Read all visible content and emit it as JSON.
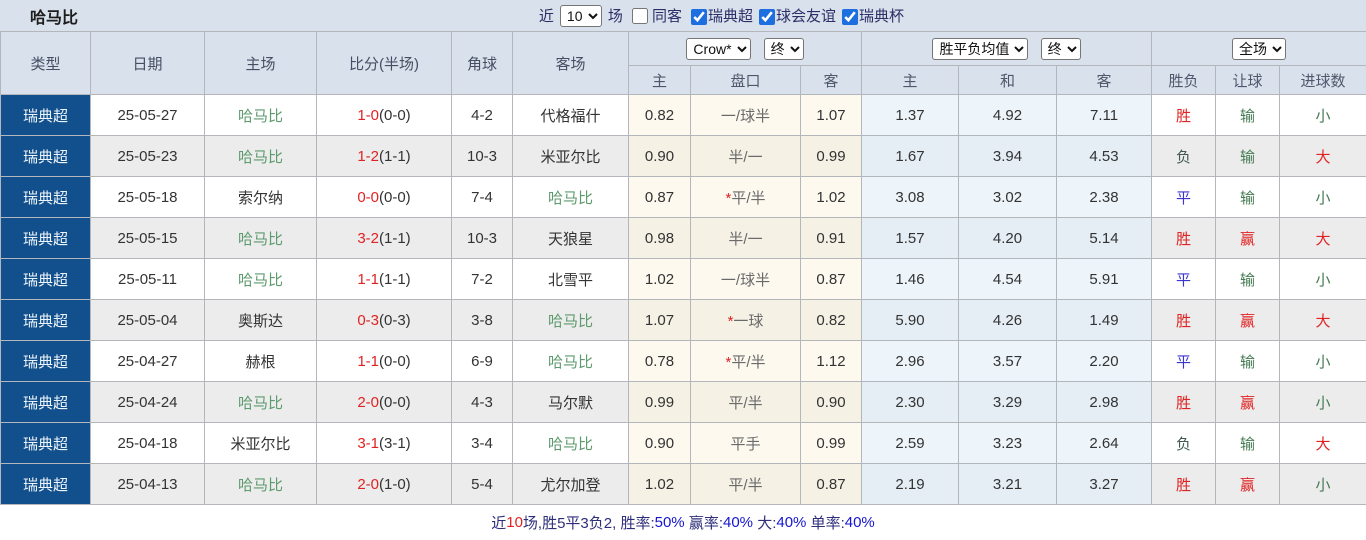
{
  "topbar": {
    "title": "哈马比",
    "recent_label": "近",
    "recent_value": "10",
    "matches_label": "场",
    "same_venue": {
      "label": "同客",
      "checked": false
    },
    "filters": [
      {
        "label": "瑞典超",
        "checked": true
      },
      {
        "label": "球会友谊",
        "checked": true
      },
      {
        "label": "瑞典杯",
        "checked": true
      }
    ]
  },
  "table": {
    "static_headers": {
      "type": "类型",
      "date": "日期",
      "home": "主场",
      "score": "比分(半场)",
      "corners": "角球",
      "away": "客场"
    },
    "handicap_group": {
      "provider_select": "Crow*",
      "time_select": "终",
      "subheaders": [
        "主",
        "盘口",
        "客"
      ]
    },
    "odds_group": {
      "type_select": "胜平负均值",
      "time_select": "终",
      "subheaders": [
        "主",
        "和",
        "客"
      ]
    },
    "result_group": {
      "scope_select": "全场",
      "subheaders": [
        "胜负",
        "让球",
        "进球数"
      ]
    },
    "colors": {
      "accent_header_bg": "#d9e1ec",
      "league_bg": "#11508c",
      "red": "#e02222",
      "green": "#457a52",
      "blue": "#3c35cc"
    },
    "rows": [
      {
        "league": "瑞典超",
        "date": "25-05-27",
        "home": "哈马比",
        "home_is_subject": true,
        "score": "1-0",
        "half": "(0-0)",
        "corners": "4-2",
        "away": "代格福什",
        "away_is_subject": false,
        "ah_home": "0.82",
        "ah_star": false,
        "ah_line": "一/球半",
        "ah_away": "1.07",
        "eu_home": "1.37",
        "eu_draw": "4.92",
        "eu_away": "7.11",
        "result": "胜",
        "result_color": "red",
        "handicap_result": "输",
        "handicap_color": "green",
        "goals": "小",
        "goals_color": "green"
      },
      {
        "league": "瑞典超",
        "date": "25-05-23",
        "home": "哈马比",
        "home_is_subject": true,
        "score": "1-2",
        "half": "(1-1)",
        "corners": "10-3",
        "away": "米亚尔比",
        "away_is_subject": false,
        "ah_home": "0.90",
        "ah_star": false,
        "ah_line": "半/一",
        "ah_away": "0.99",
        "eu_home": "1.67",
        "eu_draw": "3.94",
        "eu_away": "4.53",
        "result": "负",
        "result_color": "dark",
        "handicap_result": "输",
        "handicap_color": "green",
        "goals": "大",
        "goals_color": "red"
      },
      {
        "league": "瑞典超",
        "date": "25-05-18",
        "home": "索尔纳",
        "home_is_subject": false,
        "score": "0-0",
        "half": "(0-0)",
        "corners": "7-4",
        "away": "哈马比",
        "away_is_subject": true,
        "ah_home": "0.87",
        "ah_star": true,
        "ah_line": "平/半",
        "ah_away": "1.02",
        "eu_home": "3.08",
        "eu_draw": "3.02",
        "eu_away": "2.38",
        "result": "平",
        "result_color": "blue",
        "handicap_result": "输",
        "handicap_color": "green",
        "goals": "小",
        "goals_color": "green"
      },
      {
        "league": "瑞典超",
        "date": "25-05-15",
        "home": "哈马比",
        "home_is_subject": true,
        "score": "3-2",
        "half": "(1-1)",
        "corners": "10-3",
        "away": "天狼星",
        "away_is_subject": false,
        "ah_home": "0.98",
        "ah_star": false,
        "ah_line": "半/一",
        "ah_away": "0.91",
        "eu_home": "1.57",
        "eu_draw": "4.20",
        "eu_away": "5.14",
        "result": "胜",
        "result_color": "red",
        "handicap_result": "赢",
        "handicap_color": "red",
        "goals": "大",
        "goals_color": "red"
      },
      {
        "league": "瑞典超",
        "date": "25-05-11",
        "home": "哈马比",
        "home_is_subject": true,
        "score": "1-1",
        "half": "(1-1)",
        "corners": "7-2",
        "away": "北雪平",
        "away_is_subject": false,
        "ah_home": "1.02",
        "ah_star": false,
        "ah_line": "一/球半",
        "ah_away": "0.87",
        "eu_home": "1.46",
        "eu_draw": "4.54",
        "eu_away": "5.91",
        "result": "平",
        "result_color": "blue",
        "handicap_result": "输",
        "handicap_color": "green",
        "goals": "小",
        "goals_color": "green"
      },
      {
        "league": "瑞典超",
        "date": "25-05-04",
        "home": "奥斯达",
        "home_is_subject": false,
        "score": "0-3",
        "half": "(0-3)",
        "corners": "3-8",
        "away": "哈马比",
        "away_is_subject": true,
        "ah_home": "1.07",
        "ah_star": true,
        "ah_line": "一球",
        "ah_away": "0.82",
        "eu_home": "5.90",
        "eu_draw": "4.26",
        "eu_away": "1.49",
        "result": "胜",
        "result_color": "red",
        "handicap_result": "赢",
        "handicap_color": "red",
        "goals": "大",
        "goals_color": "red"
      },
      {
        "league": "瑞典超",
        "date": "25-04-27",
        "home": "赫根",
        "home_is_subject": false,
        "score": "1-1",
        "half": "(0-0)",
        "corners": "6-9",
        "away": "哈马比",
        "away_is_subject": true,
        "ah_home": "0.78",
        "ah_star": true,
        "ah_line": "平/半",
        "ah_away": "1.12",
        "eu_home": "2.96",
        "eu_draw": "3.57",
        "eu_away": "2.20",
        "result": "平",
        "result_color": "blue",
        "handicap_result": "输",
        "handicap_color": "green",
        "goals": "小",
        "goals_color": "green"
      },
      {
        "league": "瑞典超",
        "date": "25-04-24",
        "home": "哈马比",
        "home_is_subject": true,
        "score": "2-0",
        "half": "(0-0)",
        "corners": "4-3",
        "away": "马尔默",
        "away_is_subject": false,
        "ah_home": "0.99",
        "ah_star": false,
        "ah_line": "平/半",
        "ah_away": "0.90",
        "eu_home": "2.30",
        "eu_draw": "3.29",
        "eu_away": "2.98",
        "result": "胜",
        "result_color": "red",
        "handicap_result": "赢",
        "handicap_color": "red",
        "goals": "小",
        "goals_color": "green"
      },
      {
        "league": "瑞典超",
        "date": "25-04-18",
        "home": "米亚尔比",
        "home_is_subject": false,
        "score": "3-1",
        "half": "(3-1)",
        "corners": "3-4",
        "away": "哈马比",
        "away_is_subject": true,
        "ah_home": "0.90",
        "ah_star": false,
        "ah_line": "平手",
        "ah_away": "0.99",
        "eu_home": "2.59",
        "eu_draw": "3.23",
        "eu_away": "2.64",
        "result": "负",
        "result_color": "dark",
        "handicap_result": "输",
        "handicap_color": "green",
        "goals": "大",
        "goals_color": "red"
      },
      {
        "league": "瑞典超",
        "date": "25-04-13",
        "home": "哈马比",
        "home_is_subject": true,
        "score": "2-0",
        "half": "(1-0)",
        "corners": "5-4",
        "away": "尤尔加登",
        "away_is_subject": false,
        "ah_home": "1.02",
        "ah_star": false,
        "ah_line": "平/半",
        "ah_away": "0.87",
        "eu_home": "2.19",
        "eu_draw": "3.21",
        "eu_away": "3.27",
        "result": "胜",
        "result_color": "red",
        "handicap_result": "赢",
        "handicap_color": "red",
        "goals": "小",
        "goals_color": "green"
      }
    ]
  },
  "footer": {
    "segments": [
      {
        "text": "近",
        "color": "navy"
      },
      {
        "text": "10",
        "color": "red"
      },
      {
        "text": "场,胜5平3负2, 胜率:",
        "color": "navy"
      },
      {
        "text": "50%",
        "color": "blue"
      },
      {
        "text": " 赢率:",
        "color": "navy"
      },
      {
        "text": "40%",
        "color": "blue"
      },
      {
        "text": " 大:",
        "color": "navy"
      },
      {
        "text": "40%",
        "color": "blue"
      },
      {
        "text": " 单率:",
        "color": "navy"
      },
      {
        "text": "40%",
        "color": "blue"
      }
    ]
  }
}
